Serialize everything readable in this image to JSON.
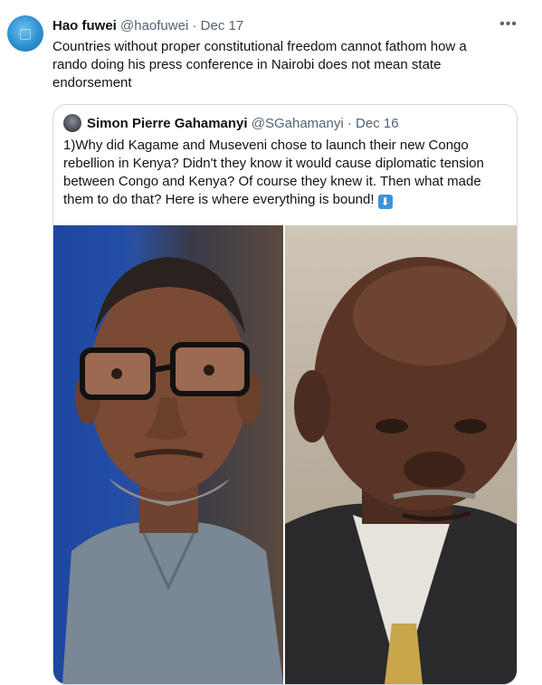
{
  "tweet": {
    "author_name": "Hao fuwei",
    "author_handle": "@haofuwei",
    "separator": "·",
    "date": "Dec 17",
    "more_icon": "more-options-icon",
    "text": "Countries without proper constitutional freedom cannot fathom how a rando doing his press conference in Nairobi does not mean state endorsement"
  },
  "quoted_tweet": {
    "author_name": "Simon Pierre Gahamanyi",
    "author_handle": "@SGahamanyi",
    "separator": "·",
    "date": "Dec 16",
    "text": "1)Why did Kagame and Museveni chose to launch their new Congo rebellion in Kenya? Didn't they know it would cause diplomatic tension between Congo and Kenya? Of course they knew it. Then what made them to do that? Here is where everything is bound!",
    "emoji": "⬇"
  },
  "media": [
    {
      "icon": "portrait-photo-left",
      "description_visible": ""
    },
    {
      "icon": "portrait-photo-right",
      "description_visible": ""
    }
  ],
  "colors": {
    "text_primary": "#0f1419",
    "text_muted": "#536471",
    "border": "#cfd9de",
    "avatar_blue": "#2f8fd0"
  }
}
